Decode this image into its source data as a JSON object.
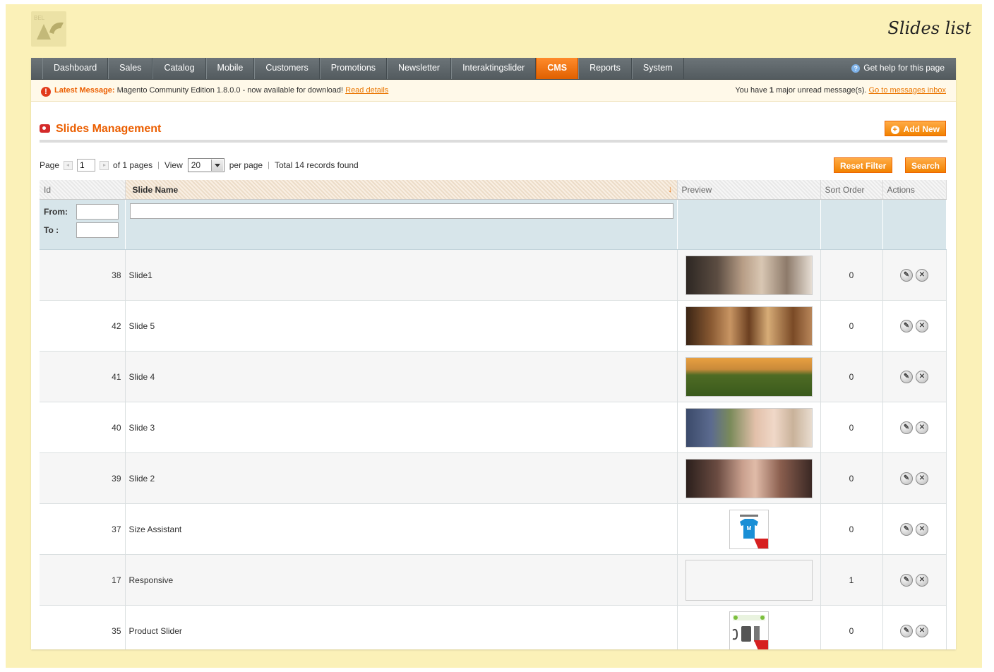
{
  "page_title": "Slides list",
  "nav": {
    "items": [
      "Dashboard",
      "Sales",
      "Catalog",
      "Mobile",
      "Customers",
      "Promotions",
      "Newsletter",
      "Interaktingslider",
      "CMS",
      "Reports",
      "System"
    ],
    "active": "CMS",
    "help": "Get help for this page"
  },
  "message": {
    "latest_label": "Latest Message:",
    "text": "Magento Community Edition 1.8.0.0 - now available for download!",
    "read_link": "Read details",
    "unread_prefix": "You have",
    "unread_count": "1",
    "unread_suffix": "major unread message(s).",
    "inbox_link": "Go to messages inbox"
  },
  "management": {
    "title": "Slides Management",
    "add_new": "Add New"
  },
  "pager": {
    "page_label": "Page",
    "page_value": "1",
    "of_pages": "of 1 pages",
    "view_label": "View",
    "per_page_value": "20",
    "per_page_label": "per page",
    "total": "Total 14 records found",
    "reset_filter": "Reset Filter",
    "search": "Search"
  },
  "grid": {
    "columns": {
      "id": "Id",
      "name": "Slide Name",
      "preview": "Preview",
      "sort_order": "Sort Order",
      "actions": "Actions"
    },
    "filter": {
      "from": "From:",
      "to": "To :"
    },
    "rows": [
      {
        "id": "38",
        "name": "Slide1",
        "sort_order": "0",
        "preview": "portrait-woman-lying"
      },
      {
        "id": "42",
        "name": "Slide 5",
        "sort_order": "0",
        "preview": "coffee-cups"
      },
      {
        "id": "41",
        "name": "Slide 4",
        "sort_order": "0",
        "preview": "vineyard-wine"
      },
      {
        "id": "40",
        "name": "Slide 3",
        "sort_order": "0",
        "preview": "two-women-flowers"
      },
      {
        "id": "39",
        "name": "Slide 2",
        "sort_order": "0",
        "preview": "woman-face-jewelry"
      },
      {
        "id": "37",
        "name": "Size Assistant",
        "sort_order": "0",
        "preview": "tshirt-icon"
      },
      {
        "id": "17",
        "name": "Responsive",
        "sort_order": "1",
        "preview": "empty"
      },
      {
        "id": "35",
        "name": "Product Slider",
        "sort_order": "0",
        "preview": "product-slider-icon"
      }
    ]
  },
  "colors": {
    "accent": "#eb5e00",
    "nav_bg": "#5e666a",
    "page_bg": "#fbf1b8"
  }
}
